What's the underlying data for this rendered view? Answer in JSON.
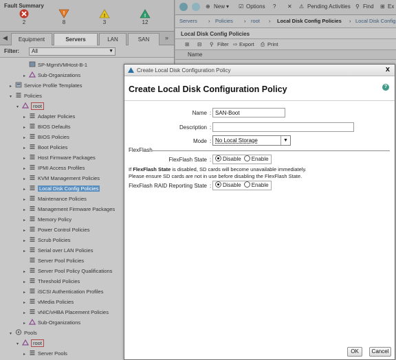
{
  "fault_summary": {
    "title": "Fault Summary",
    "counts": [
      {
        "icon": "critical-x-icon",
        "value": "2",
        "color": "#c0392b"
      },
      {
        "icon": "major-triangle-icon",
        "value": "8",
        "color": "#e07b2a"
      },
      {
        "icon": "minor-triangle-icon",
        "value": "3",
        "color": "#e6c319"
      },
      {
        "icon": "warning-triangle-icon",
        "value": "12",
        "color": "#2f9e6e"
      }
    ]
  },
  "nav_tabs": [
    "Equipment",
    "Servers",
    "LAN",
    "SAN"
  ],
  "filter": {
    "label": "Filter:",
    "value": "All"
  },
  "tree": [
    "SP-MgmtVMHost-B-1",
    "Sub-Organizations",
    "Service Profile Templates",
    "Policies",
    "root",
    "Adapter Policies",
    "BIOS Defaults",
    "BIOS Policies",
    "Boot Policies",
    "Host Firmware Packages",
    "IPMI Access Profiles",
    "KVM Management Policies",
    "Local Disk Config Policies",
    "Maintenance Policies",
    "Management Firmware Packages",
    "Memory Policy",
    "Power Control Policies",
    "Scrub Policies",
    "Serial over LAN Policies",
    "Server Pool Policies",
    "Server Pool Policy Qualifications",
    "Threshold Policies",
    "iSCSI Authentication Profiles",
    "vMedia Policies",
    "vNIC/vHBA Placement Policies",
    "Sub-Organizations",
    "Pools",
    "root",
    "Server Pools"
  ],
  "toolbar": {
    "new": "New",
    "options": "Options",
    "pending": "Pending Activities",
    "find": "Find",
    "exit": "Ex"
  },
  "breadcrumb": [
    "Servers",
    "Policies",
    "root",
    "Local Disk Config Policies",
    "Local Disk Config"
  ],
  "panel": {
    "title": "Local Disk Config Policies",
    "filter": "Filter",
    "export": "Export",
    "print": "Print",
    "name_col": "Name"
  },
  "dialog": {
    "window_title": "Create Local Disk Configuration Policy",
    "heading": "Create Local Disk Configuration Policy",
    "close": "x",
    "help": "?",
    "form": {
      "name_label": "Name",
      "name_value": "SAN-Boot",
      "description_label": "Description",
      "description_value": "",
      "mode_label": "Mode",
      "mode_value": "No Local Storage",
      "section": "FlexFlash",
      "flexflash_state_label": "FlexFlash State",
      "flexflash_state": {
        "selected": "Disable",
        "options": [
          "Disable",
          "Enable"
        ]
      },
      "note_line1_pre": "If ",
      "note_line1_bold": "FlexFlash State",
      "note_line1_post": " is disabled, SD cards will become unavailable immediately.",
      "note_line2": "Please ensure SD cards are not in use before disabling the FlexFlash State.",
      "raid_label": "FlexFlash RAID Reporting State",
      "raid_state": {
        "selected": "Disable",
        "options": [
          "Disable",
          "Enable"
        ]
      }
    },
    "ok": "OK",
    "cancel": "Cancel"
  }
}
